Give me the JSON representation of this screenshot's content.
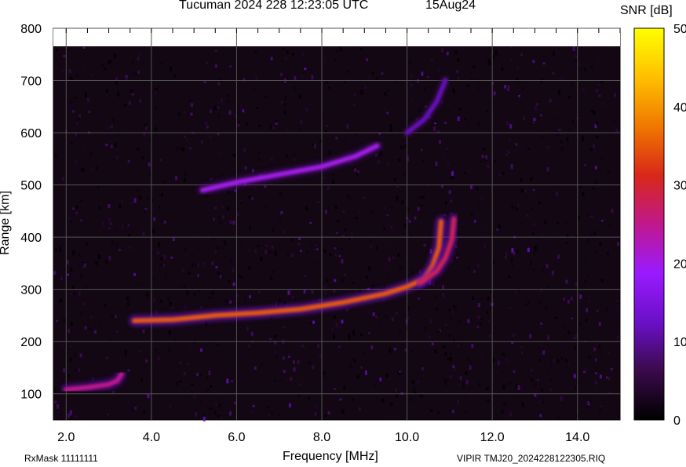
{
  "header": {
    "title": "Tucuman 2024 228 12:23:05 UTC",
    "date": "15Aug24"
  },
  "colorbar": {
    "label": "SNR [dB]",
    "ticks": [
      "0",
      "10",
      "20",
      "30",
      "40",
      "50"
    ],
    "stops": [
      "#000000",
      "#3a0a4a",
      "#6a10c8",
      "#9a1aff",
      "#c0188c",
      "#d82818",
      "#f07800",
      "#ffc000",
      "#ffff00"
    ]
  },
  "footer": {
    "rxmask": "RxMask 11111111",
    "file": "VIPIR  TMJ20_2024228122305.RIQ"
  },
  "chart_data": {
    "type": "heatmap",
    "title": "Tucuman 2024 228 12:23:05 UTC",
    "xlabel": "Frequency [MHz]",
    "ylabel": "Range [km]",
    "xlim": [
      1.7,
      15.0
    ],
    "ylim": [
      50,
      800
    ],
    "xticks": [
      "2.0",
      "4.0",
      "6.0",
      "8.0",
      "10.0",
      "12.0",
      "14.0"
    ],
    "yticks": [
      "100",
      "200",
      "300",
      "400",
      "500",
      "600",
      "700",
      "800"
    ],
    "colorbar_label": "SNR [dB]",
    "colorbar_range": [
      0,
      50
    ],
    "grid": true,
    "traces": [
      {
        "layer": "E",
        "snr_db": 25,
        "points": [
          [
            2.0,
            108
          ],
          [
            2.5,
            112
          ],
          [
            3.0,
            118
          ],
          [
            3.2,
            125
          ],
          [
            3.3,
            138
          ]
        ]
      },
      {
        "layer": "F (O-trace)",
        "snr_db": 35,
        "points": [
          [
            3.6,
            240
          ],
          [
            4.5,
            242
          ],
          [
            5.5,
            250
          ],
          [
            6.5,
            255
          ],
          [
            7.5,
            262
          ],
          [
            8.5,
            275
          ],
          [
            9.5,
            292
          ],
          [
            10.0,
            305
          ],
          [
            10.4,
            320
          ],
          [
            10.6,
            345
          ],
          [
            10.75,
            380
          ],
          [
            10.8,
            430
          ]
        ]
      },
      {
        "layer": "F (X-trace)",
        "snr_db": 28,
        "points": [
          [
            10.3,
            312
          ],
          [
            10.7,
            335
          ],
          [
            10.9,
            360
          ],
          [
            11.05,
            395
          ],
          [
            11.1,
            435
          ]
        ]
      },
      {
        "layer": "F multi-hop",
        "snr_db": 20,
        "points": [
          [
            5.2,
            490
          ],
          [
            6.0,
            505
          ],
          [
            7.0,
            520
          ],
          [
            8.0,
            535
          ],
          [
            8.8,
            555
          ],
          [
            9.3,
            575
          ]
        ]
      },
      {
        "layer": "F multi-hop high",
        "snr_db": 12,
        "points": [
          [
            10.0,
            600
          ],
          [
            10.4,
            625
          ],
          [
            10.7,
            660
          ],
          [
            10.9,
            700
          ]
        ]
      }
    ]
  }
}
